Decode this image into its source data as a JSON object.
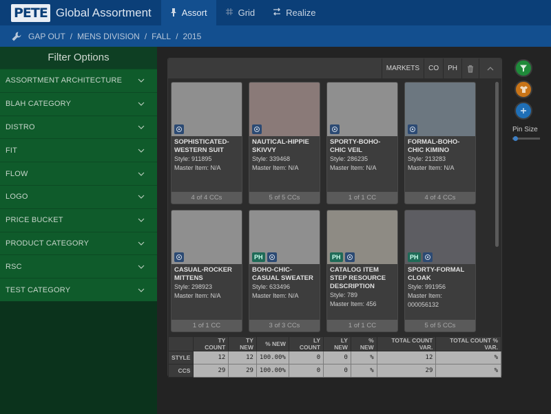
{
  "header": {
    "logo_text": "PETE",
    "app_title": "Global Assortment",
    "nav": [
      {
        "label": "Assort",
        "icon": "pin-icon",
        "active": true
      },
      {
        "label": "Grid",
        "icon": "hash-icon",
        "active": false
      },
      {
        "label": "Realize",
        "icon": "swap-icon",
        "active": false
      }
    ]
  },
  "breadcrumb": {
    "items": [
      "GAP OUT",
      "MENS DIVISION",
      "FALL",
      "2015"
    ],
    "separator": "/"
  },
  "sidebar": {
    "title": "Filter Options",
    "filters": [
      "ASSORTMENT ARCHITECTURE",
      "BLAH CATEGORY",
      "DISTRO",
      "FIT",
      "FLOW",
      "LOGO",
      "PRICE BUCKET",
      "PRODUCT CATEGORY",
      "RSC",
      "TEST CATEGORY"
    ]
  },
  "panel": {
    "tools": {
      "markets": "MARKETS",
      "co": "CO",
      "ph": "PH"
    }
  },
  "cards": [
    {
      "name": "SOPHISTICATED-WESTERN SUIT",
      "style": "Style: 911895",
      "master": "Master Item: N/A",
      "ccs": "4 of 4  CCs",
      "ph": false
    },
    {
      "name": "NAUTICAL-HIPPIE SKIVVY",
      "style": "Style: 339468",
      "master": "Master Item: N/A",
      "ccs": "5 of 5  CCs",
      "ph": false
    },
    {
      "name": "SPORTY-BOHO-CHIC VEIL",
      "style": "Style: 286235",
      "master": "Master Item: N/A",
      "ccs": "1 of 1  CC",
      "ph": false
    },
    {
      "name": "FORMAL-BOHO-CHIC KIMINO",
      "style": "Style: 213283",
      "master": "Master Item: N/A",
      "ccs": "4 of 4  CCs",
      "ph": false
    },
    {
      "name": "CASUAL-ROCKER MITTENS",
      "style": "Style: 298923",
      "master": "Master Item: N/A",
      "ccs": "1 of 1  CC",
      "ph": false
    },
    {
      "name": "BOHO-CHIC-CASUAL SWEATER",
      "style": "Style: 633496",
      "master": "Master Item: N/A",
      "ccs": "3 of 3  CCs",
      "ph": true
    },
    {
      "name": "CATALOG ITEM STEP RESOURCE DESCRIPTION",
      "style": "Style: 789",
      "master": "Master Item: 456",
      "ccs": "1 of 1  CC",
      "ph": true
    },
    {
      "name": "SPORTY-FORMAL CLOAK",
      "style": "Style: 991956",
      "master": "Master Item: 000056132",
      "ccs": "5 of 5  CCs",
      "ph": true
    }
  ],
  "ph_badge": "PH",
  "stats": {
    "headers": [
      "",
      "TY COUNT",
      "TY NEW",
      "% NEW",
      "LY COUNT",
      "LY NEW",
      "% NEW",
      "TOTAL COUNT VAR.",
      "TOTAL COUNT % VAR."
    ],
    "rows": [
      [
        "STYLE",
        "12",
        "12",
        "100.00%",
        "0",
        "0",
        "%",
        "12",
        "%"
      ],
      [
        "CCS",
        "29",
        "29",
        "100.00%",
        "0",
        "0",
        "%",
        "29",
        "%"
      ]
    ]
  },
  "right_tools": {
    "pin_size_label": "Pin Size",
    "pin_size_level": 0.1
  },
  "colors": {
    "topbar": "#0b3f78",
    "crumbbar": "#134f8f",
    "sidebar": "#0f5b2b",
    "filter_button": "#1f8a3a",
    "shirt_button": "#c87418",
    "add_button": "#1f6fb6"
  }
}
